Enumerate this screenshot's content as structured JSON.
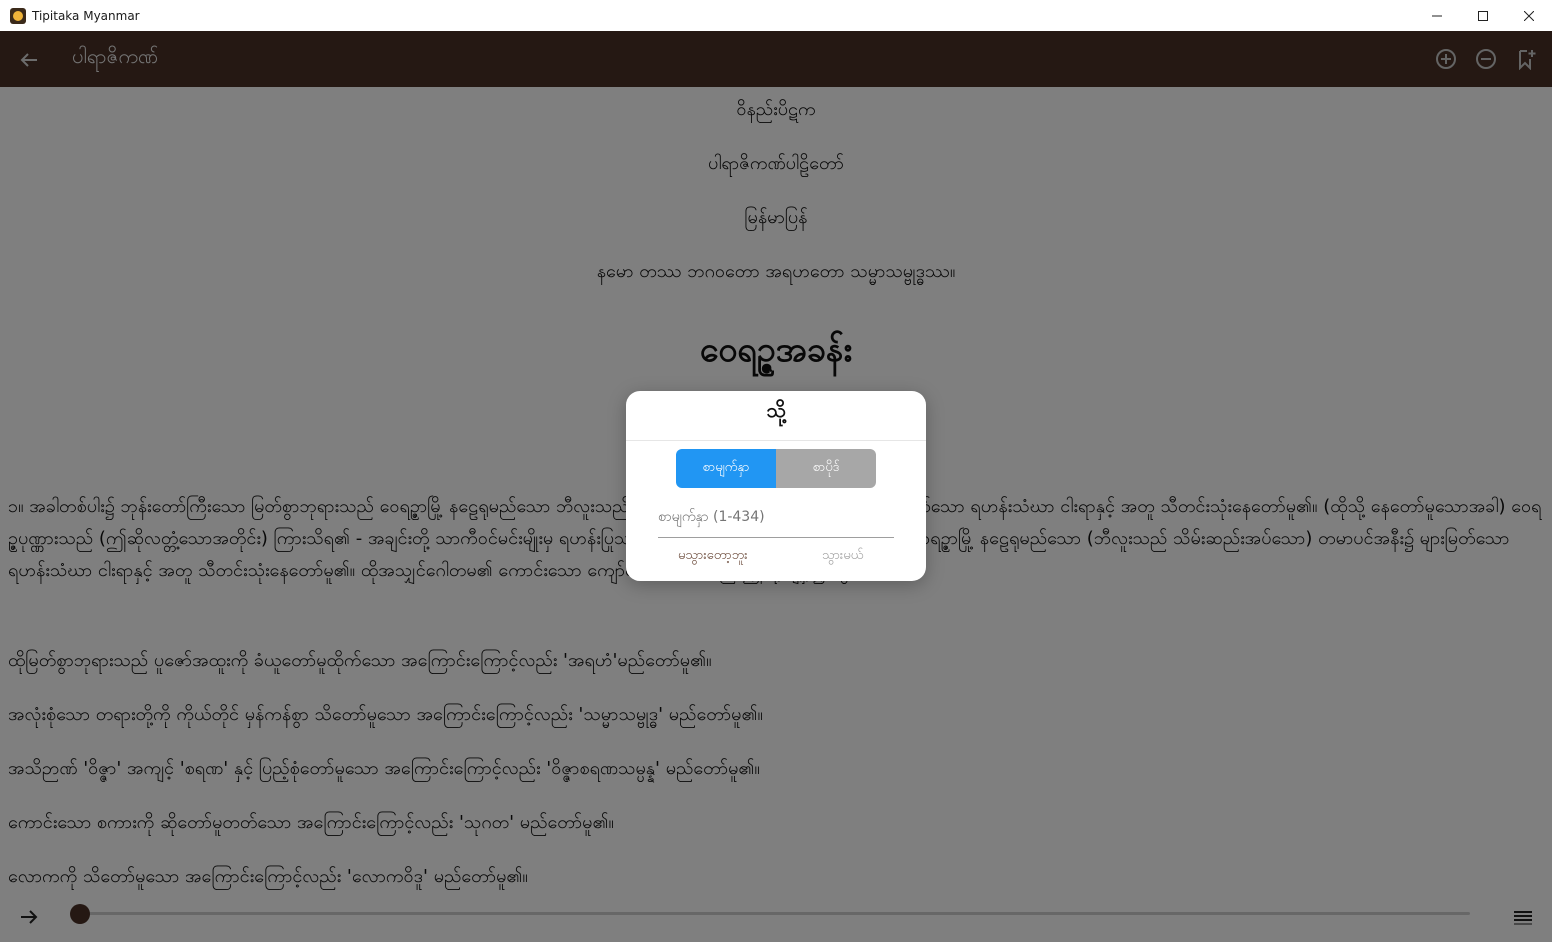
{
  "window": {
    "title": "Tipitaka Myanmar"
  },
  "appbar": {
    "title": "ပါရာဇိကဏ်"
  },
  "content": {
    "lines": [
      "ဝိနည်းပိဋက",
      "ပါရာဇိကဏ်ပါဠိတော်",
      "မြန်မာပြန်",
      "နမော တဿ ဘဂဝတော အရဟတော သမ္မာသမ္ဗုဒ္ဓဿ။"
    ],
    "chapter_title": "ဝေရဉ္ဇအခန်း",
    "paragraphs": [
      "၁။ အခါတစ်ပါး၌ ဘုန်းတော်ကြီးသော မြတ်စွာဘုရားသည် ဝေရဉ္ဇာမြို့ နဠေရုမည်သော ဘီလူးသည် သိမ်းဆည်းအပ်သော တမာပင်အနီး၌ များမြတ်သော ရဟန်းသံဃာ ငါးရာနှင့် အတူ သီတင်းသုံးနေတော်မူ၏။ (ထိုသို့ နေတော်မူသောအခါ) ဝေရဉ္ဇပုဏ္ဏားသည် (ဤဆိုလတ္တံ့သောအတိုင်း) ကြားသိရ၏ - အချင်းတို့ သာကီဝင်မင်းမျိုးမှ ရဟန်းပြုသည့် သာကီဝင်မင်းသား ရဟန်းဂေါတမသည် ဝေရဉ္ဇာမြို့ နဠေရုမည်သော (ဘီလူးသည် သိမ်းဆည်းအပ်သော) တမာပင်အနီး၌ များမြတ်သော ရဟန်းသံဃာ ငါးရာနှင့် အတူ သီတင်းသုံးနေတော်မူ၏။ ထိုအသျှင်ဂေါတမ၏ ကောင်းသော ကျော်စောသတင်းသည် ဤသို့ ပျံ့နှံ့၍ ထွက်၏။",
      "ထိုမြတ်စွာဘုရားသည် ပူဇော်အထူးကို ခံယူတော်မူထိုက်သော အကြောင်းကြောင့်လည်း 'အရဟံ'မည်တော်မူ၏။",
      "အလုံးစုံသော တရားတို့ကို ကိုယ်တိုင် မှန်ကန်စွာ သိတော်မူသော အကြောင်းကြောင့်လည်း 'သမ္မာသမ္ဗုဒ္ဓ' မည်တော်မူ၏။",
      "အသိဉာဏ် 'ဝိဇ္ဇာ' အကျင့် 'စရဏ' နှင့် ပြည့်စုံတော်မူသော အကြောင်းကြောင့်လည်း 'ဝိဇ္ဇာစရဏသမ္ပန္န' မည်တော်မူ၏။",
      "ကောင်းသော စကားကို ဆိုတော်မူတတ်သော အကြောင်းကြောင့်လည်း 'သုဂတ' မည်တော်မူ၏။",
      "လောကကို သိတော်မူသော အကြောင်းကြောင့်လည်း 'လောကဝိဒူ' မည်တော်မူ၏။"
    ]
  },
  "slider": {
    "progress": 0.0
  },
  "dialog": {
    "title": "သို့",
    "segments": [
      {
        "label": "စာမျက်နှာ",
        "active": true
      },
      {
        "label": "စာပိုဒ်",
        "active": false
      }
    ],
    "input_placeholder": "စာမျက်နှာ (1-434)",
    "cancel_label": "မသွားတော့ဘူး",
    "go_label": "သွားမယ်"
  },
  "colors": {
    "appbar": "#4a3127",
    "accent": "#2196f3",
    "segment_inactive": "#a7a7a7"
  },
  "icons": [
    "back-arrow-icon",
    "zoom-in-icon",
    "zoom-out-icon",
    "bookmark-add-icon",
    "forward-arrow-icon",
    "toc-list-icon"
  ]
}
